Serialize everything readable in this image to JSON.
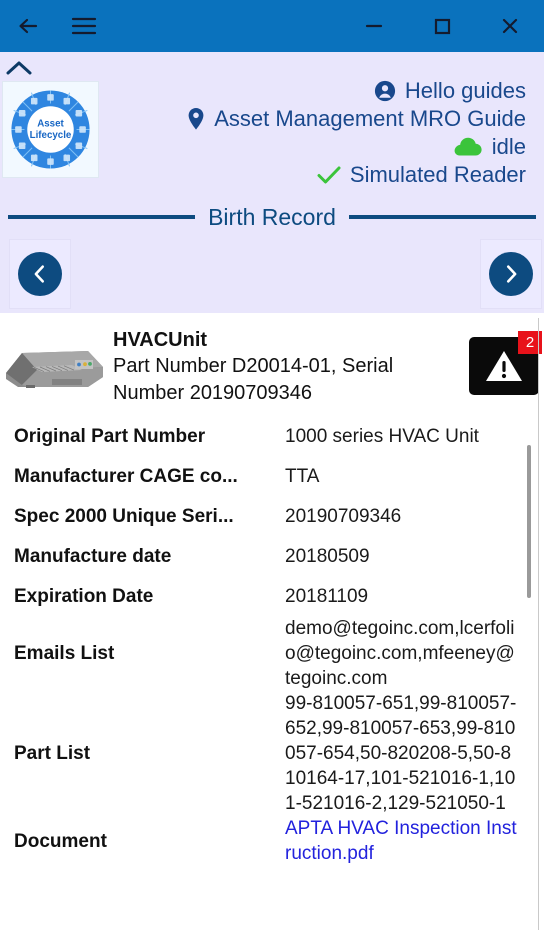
{
  "window": {
    "back_label": "back",
    "menu_label": "menu",
    "minimize_label": "minimize",
    "maximize_label": "maximize",
    "close_label": "close",
    "titlebar_color": "#0a72bd"
  },
  "header": {
    "collapse_label": "collapse",
    "logo_text_line1": "Asset",
    "logo_text_line2": "Lifecycle",
    "greeting": "Hello guides",
    "guide_name": "Asset Management MRO Guide",
    "status": "idle",
    "reader": "Simulated Reader",
    "accent_color": "#19488c",
    "cloud_color": "#3bc43b",
    "check_color": "#3bc43b",
    "background": "#e9e6fc"
  },
  "record": {
    "title": "Birth Record",
    "rule_color": "#0d4b80",
    "prev_label": "previous record",
    "next_label": "next record"
  },
  "asset": {
    "name": "HVACUnit",
    "subtitle": "Part Number D20014-01, Serial Number 20190709346",
    "alert_count": "2",
    "alert_color": "#e8121a"
  },
  "details": [
    {
      "label": "Original Part Number",
      "value": "1000 series HVAC Unit",
      "link": false
    },
    {
      "label": "Manufacturer CAGE co...",
      "value": "TTA",
      "link": false
    },
    {
      "label": "Spec 2000 Unique Seri...",
      "value": "20190709346",
      "link": false
    },
    {
      "label": "Manufacture date",
      "value": "20180509",
      "link": false
    },
    {
      "label": "Expiration Date",
      "value": "20181109",
      "link": false
    },
    {
      "label": "Emails List",
      "value": "demo@tegoinc.com,lcerfolio@tegoinc.com,mfeeney@tegoinc.com",
      "link": false
    },
    {
      "label": "Part List",
      "value": "99-810057-651,99-810057-652,99-810057-653,99-810057-654,50-820208-5,50-810164-17,101-521016-1,101-521016-2,129-521050-1",
      "link": false
    },
    {
      "label": "Document",
      "value": "APTA HVAC Inspection Instruction.pdf",
      "link": true
    }
  ]
}
